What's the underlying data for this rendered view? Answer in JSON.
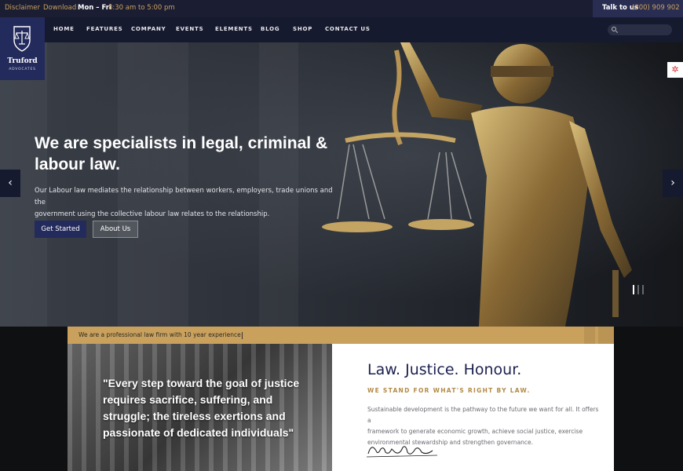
{
  "topbar": {
    "disclaimer": "Disclaimer",
    "download": "Download",
    "hours_label": "Mon – Fri",
    "hours_value": "8:30 am to 5:00 pm",
    "talk_label": "Talk to us",
    "phone": "(800) 909 902"
  },
  "logo": {
    "name": "Truford",
    "tagline": "ADVOCATES"
  },
  "nav": {
    "items": [
      "HOME",
      "FEATURES",
      "COMPANY",
      "EVENTS",
      "ELEMENTS",
      "BLOG",
      "SHOP",
      "CONTACT US"
    ]
  },
  "hero": {
    "title_line1": "We are specialists in legal, criminal &",
    "title_line2": "labour law.",
    "desc_line1": "Our Labour law mediates the relationship between workers, employers, trade unions and the",
    "desc_line2": "government using the collective labour law relates to the relationship.",
    "btn_primary": "Get Started",
    "btn_secondary": "About Us",
    "prev_icon": "‹",
    "next_icon": "›"
  },
  "strip": {
    "text": "We are a professional law firm with 10 year experience"
  },
  "quote": {
    "line1": "\"Every step toward the goal of justice",
    "line2": "requires sacrifice, suffering, and",
    "line3": "struggle; the tireless exertions and",
    "line4": "passionate of dedicated individuals\""
  },
  "info": {
    "title": "Law. Justice. Honour.",
    "subtitle": "WE STAND FOR WHAT'S RIGHT BY LAW.",
    "body_line1": "Sustainable development is the pathway to the future we want for all. It offers a",
    "body_line2": "framework to generate economic growth, achieve social justice, exercise",
    "body_line3": "environmental stewardship and strengthen governance."
  },
  "colors": {
    "navy": "#232a5c",
    "gold": "#c9a15c",
    "dark": "#161a2e"
  }
}
